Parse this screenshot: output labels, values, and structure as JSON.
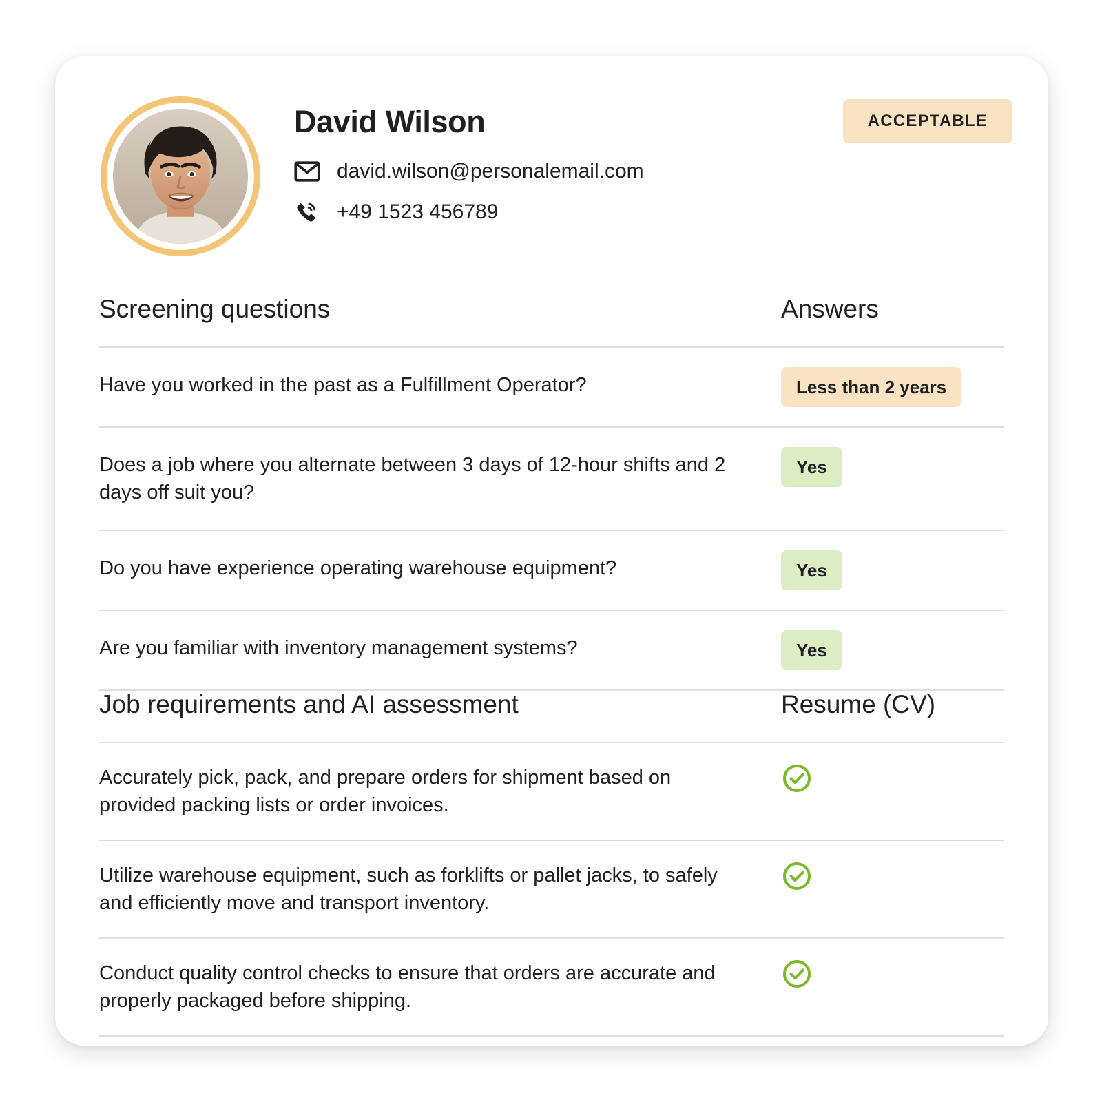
{
  "candidate": {
    "name": "David Wilson",
    "email": "david.wilson@personalemail.com",
    "phone": "+49 1523 456789",
    "status_badge": "ACCEPTABLE",
    "avatar_icon": "person-photo",
    "email_icon": "mail-icon",
    "phone_icon": "phone-in-talk-icon"
  },
  "screening": {
    "title": "Screening questions",
    "answers_header": "Answers",
    "rows": [
      {
        "question": "Have you worked in the past as a Fulfillment Operator?",
        "answer": "Less than 2 years",
        "tone": "amber"
      },
      {
        "question": "Does a job where you alternate between 3 days of 12-hour shifts and 2 days off suit you?",
        "answer": "Yes",
        "tone": "green"
      },
      {
        "question": "Do you have experience operating warehouse equipment?",
        "answer": "Yes",
        "tone": "green"
      },
      {
        "question": "Are you familiar with inventory management systems?",
        "answer": "Yes",
        "tone": "green"
      }
    ]
  },
  "requirements": {
    "title": "Job requirements and AI assessment",
    "resume_header": "Resume (CV)",
    "rows": [
      {
        "requirement": "Accurately pick, pack, and prepare orders for shipment based on provided packing lists or order invoices.",
        "result_icon": "check-circle-icon"
      },
      {
        "requirement": "Utilize warehouse equipment, such as forklifts or pallet jacks, to safely and efficiently move and transport inventory.",
        "result_icon": "check-circle-icon"
      },
      {
        "requirement": "Conduct quality control checks to ensure that orders are accurate and properly packaged before shipping.",
        "result_icon": "check-circle-icon"
      }
    ]
  },
  "colors": {
    "amber_badge_bg": "#FAE3C2",
    "green_badge_bg": "#DCEDC3",
    "check_green": "#7AB929",
    "avatar_ring": "#F3C677",
    "divider": "#DEDEE1",
    "text": "#202124",
    "card_bg": "#FFFFFF"
  }
}
